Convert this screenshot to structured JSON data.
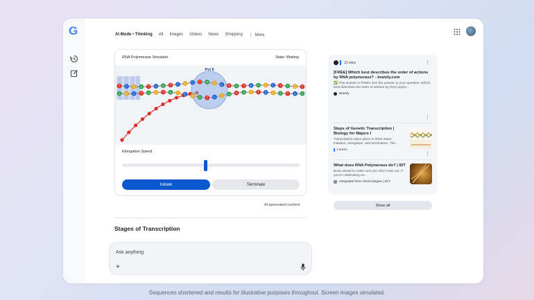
{
  "app": {
    "logo": "G"
  },
  "nav": {
    "ai_mode": "AI Mode",
    "separator": "•",
    "thinking": "Thinking",
    "items": [
      "All",
      "Images",
      "Videos",
      "News",
      "Shopping"
    ],
    "more": "More"
  },
  "simulator": {
    "title": "RNA Polymerase Simulator",
    "state": "State: Waiting",
    "polymerase_label": "Pol II",
    "speed_label": "Elongation Speed",
    "speed_value": 0.47,
    "initiate_label": "Initiate",
    "terminate_label": "Terminate",
    "strand_top": [
      "T",
      "C",
      "G",
      "A",
      "T",
      "C",
      "A",
      "T",
      "C",
      "G",
      "C",
      "T",
      "A",
      "G",
      "C",
      "T",
      "A",
      "T",
      "C",
      "A",
      "G",
      "C",
      "T",
      "A",
      "G",
      "T"
    ],
    "strand_bottom": [
      "A",
      "G",
      "C",
      "T",
      "A",
      "G",
      "T",
      "A",
      "G",
      "C",
      "G",
      "A",
      "T",
      "C",
      "G",
      "A",
      "T",
      "A",
      "G",
      "T",
      "C",
      "G",
      "A",
      "T",
      "C",
      "A"
    ],
    "base_colors": {
      "A": "#2e9e4f",
      "T": "#d93025",
      "C": "#1a5fd0",
      "G": "#e8a317"
    },
    "rna_color": "#d93025"
  },
  "ai_generated": "AI-generated content",
  "section_title": "Stages of Transcription",
  "input": {
    "placeholder": "Ask anything"
  },
  "sources": {
    "count": "13 sites",
    "cards": [
      {
        "title": "[FREE] Which best describes the order of actions by RNA polymerase? - brainly.com",
        "desc": "✅ This answer is FREE! See the answer to your question: Which best describes the order of actions by RNA polym...",
        "site": "Brainly"
      },
      {
        "title": "Steps of Genetic Transcription | Biology for Majors I",
        "desc": "Transcription takes place in three steps: initiation, elongation, and termination. The...",
        "site": "Lumen"
      },
      {
        "title": "What does RNA Polymerase do? | IDT",
        "desc": "Book ahead to make sure you don't miss out. If you're celebrating an...",
        "site": "Integrated DNA Technologies | IDT"
      }
    ],
    "show_all": "Show all"
  },
  "footer": "Sequences shortened and results for illustrative purposes throughout. Screen images simulated."
}
